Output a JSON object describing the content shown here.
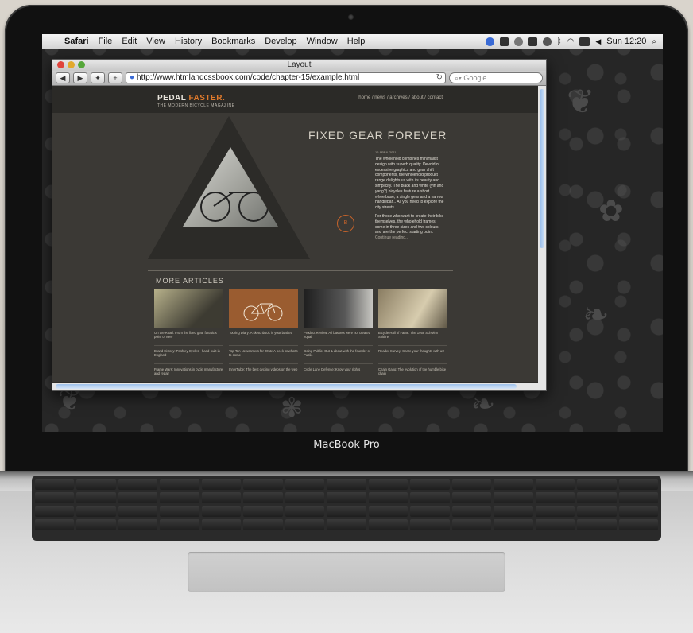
{
  "menubar": {
    "app": "Safari",
    "items": [
      "File",
      "Edit",
      "View",
      "History",
      "Bookmarks",
      "Develop",
      "Window",
      "Help"
    ],
    "clock": "Sun 12:20"
  },
  "browser": {
    "title": "Layout",
    "url": "http://www.htmlandcssbook.com/code/chapter-15/example.html",
    "search_placeholder": "Google"
  },
  "site": {
    "logo_a": "PEDAL ",
    "logo_b": "FASTER.",
    "tagline": "THE MODERN BICYCLE MAGAZINE",
    "nav": "home / news / archives / about / contact",
    "hero_title": "FIXED GEAR FOREVER",
    "hero_date": "16 APRIL 2011",
    "hero_p1": "The wholehold combines minimalist design with superb quality. Devoid of excessive graphics and gear shift components, the wholehold product range delights us with its beauty and simplicity. The black and white (yin and yang?) bicycles feature a short wheelbase, a single gear and a narrow handlebar... All you need to explore the city streets.",
    "hero_p2": "For those who want to create their bike themselves, the wholehold frames come in three sizes and two colours and are the perfect starting point.",
    "hero_more": "Continue reading...",
    "seal": "B",
    "more_title": "MORE ARTICLES",
    "columns": [
      [
        "On the Road: From the fixed gear fanatic's point of view",
        "Brand History: Pashley Cycles - hand-built in England",
        "Frame Wars: Innovations in cycle manufacture and repair"
      ],
      [
        "Touring Diary: A sketchbook in your basket",
        "Top Ten Newcomers for 2011: A peek at what's to come",
        "InnerTube: The best cycling videos on the web"
      ],
      [
        "Product Review: All baskets were not created equal",
        "Going Public: Out & about with the founder of Public",
        "Cycle Lane Defense: Know your rights"
      ],
      [
        "Bicycle Hall of Fame: The 1958 Schwinn Spitfire",
        "Reader Survey: Share your thoughts with us!",
        "Chain Gang: The evolution of the humble bike chain"
      ]
    ]
  },
  "laptop": {
    "label": "MacBook Pro"
  }
}
